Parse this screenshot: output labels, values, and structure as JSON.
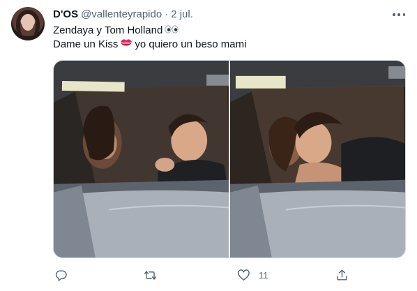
{
  "tweet": {
    "author_name": "D'OS",
    "author_handle": "@vallenteyrapido",
    "separator": "·",
    "time": "2 jul.",
    "line1": "Zendaya y Tom Holland",
    "line1_emoji": "eyes-emoji",
    "line2_before": "Dame un Kiss",
    "line2_emoji": "kiss-lips-emoji",
    "line2_after": "yo quiero un beso mami"
  },
  "media": {
    "photos": [
      "car-photo-1",
      "car-photo-2"
    ]
  },
  "actions": {
    "reply_icon": "reply-icon",
    "retweet_icon": "retweet-icon",
    "like_icon": "heart-icon",
    "like_count": "11",
    "share_icon": "share-icon"
  },
  "colors": {
    "text": "#0f1419",
    "secondary": "#536471",
    "border": "#cfd9de"
  }
}
